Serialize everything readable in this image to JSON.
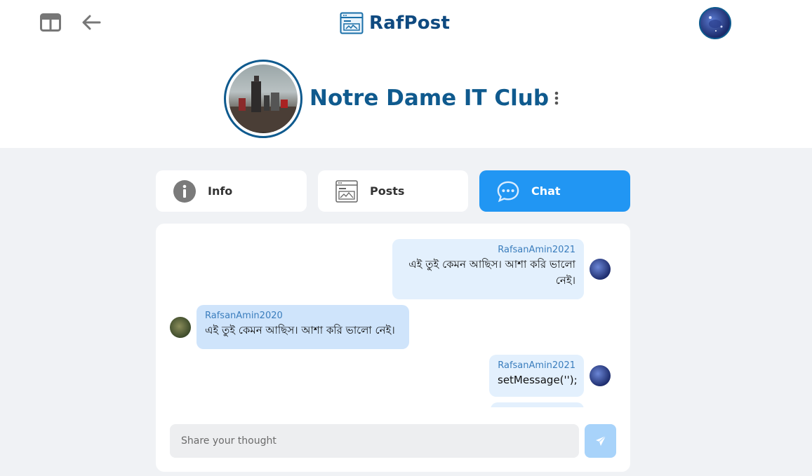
{
  "app": {
    "name": "RafPost"
  },
  "group": {
    "title": "Notre Dame IT Club"
  },
  "tabs": [
    {
      "label": "Info",
      "icon": "info-icon"
    },
    {
      "label": "Posts",
      "icon": "posts-icon"
    },
    {
      "label": "Chat",
      "icon": "chat-icon",
      "active": true
    }
  ],
  "messages": [
    {
      "author": "RafsanAmin2021",
      "text": "এই তুই কেমন আছিস। আশা করি ভালো নেই।",
      "direction": "out"
    },
    {
      "author": "RafsanAmin2020",
      "text": "এই তুই কেমন আছিস। আশা করি ভালো নেই।",
      "direction": "in"
    },
    {
      "author": "RafsanAmin2021",
      "text": "setMessage('');",
      "direction": "out"
    }
  ],
  "composer": {
    "placeholder": "Share your thought"
  },
  "colors": {
    "accent": "#2196f3",
    "brand": "#0f5a8e",
    "background": "#f0f2f5"
  }
}
